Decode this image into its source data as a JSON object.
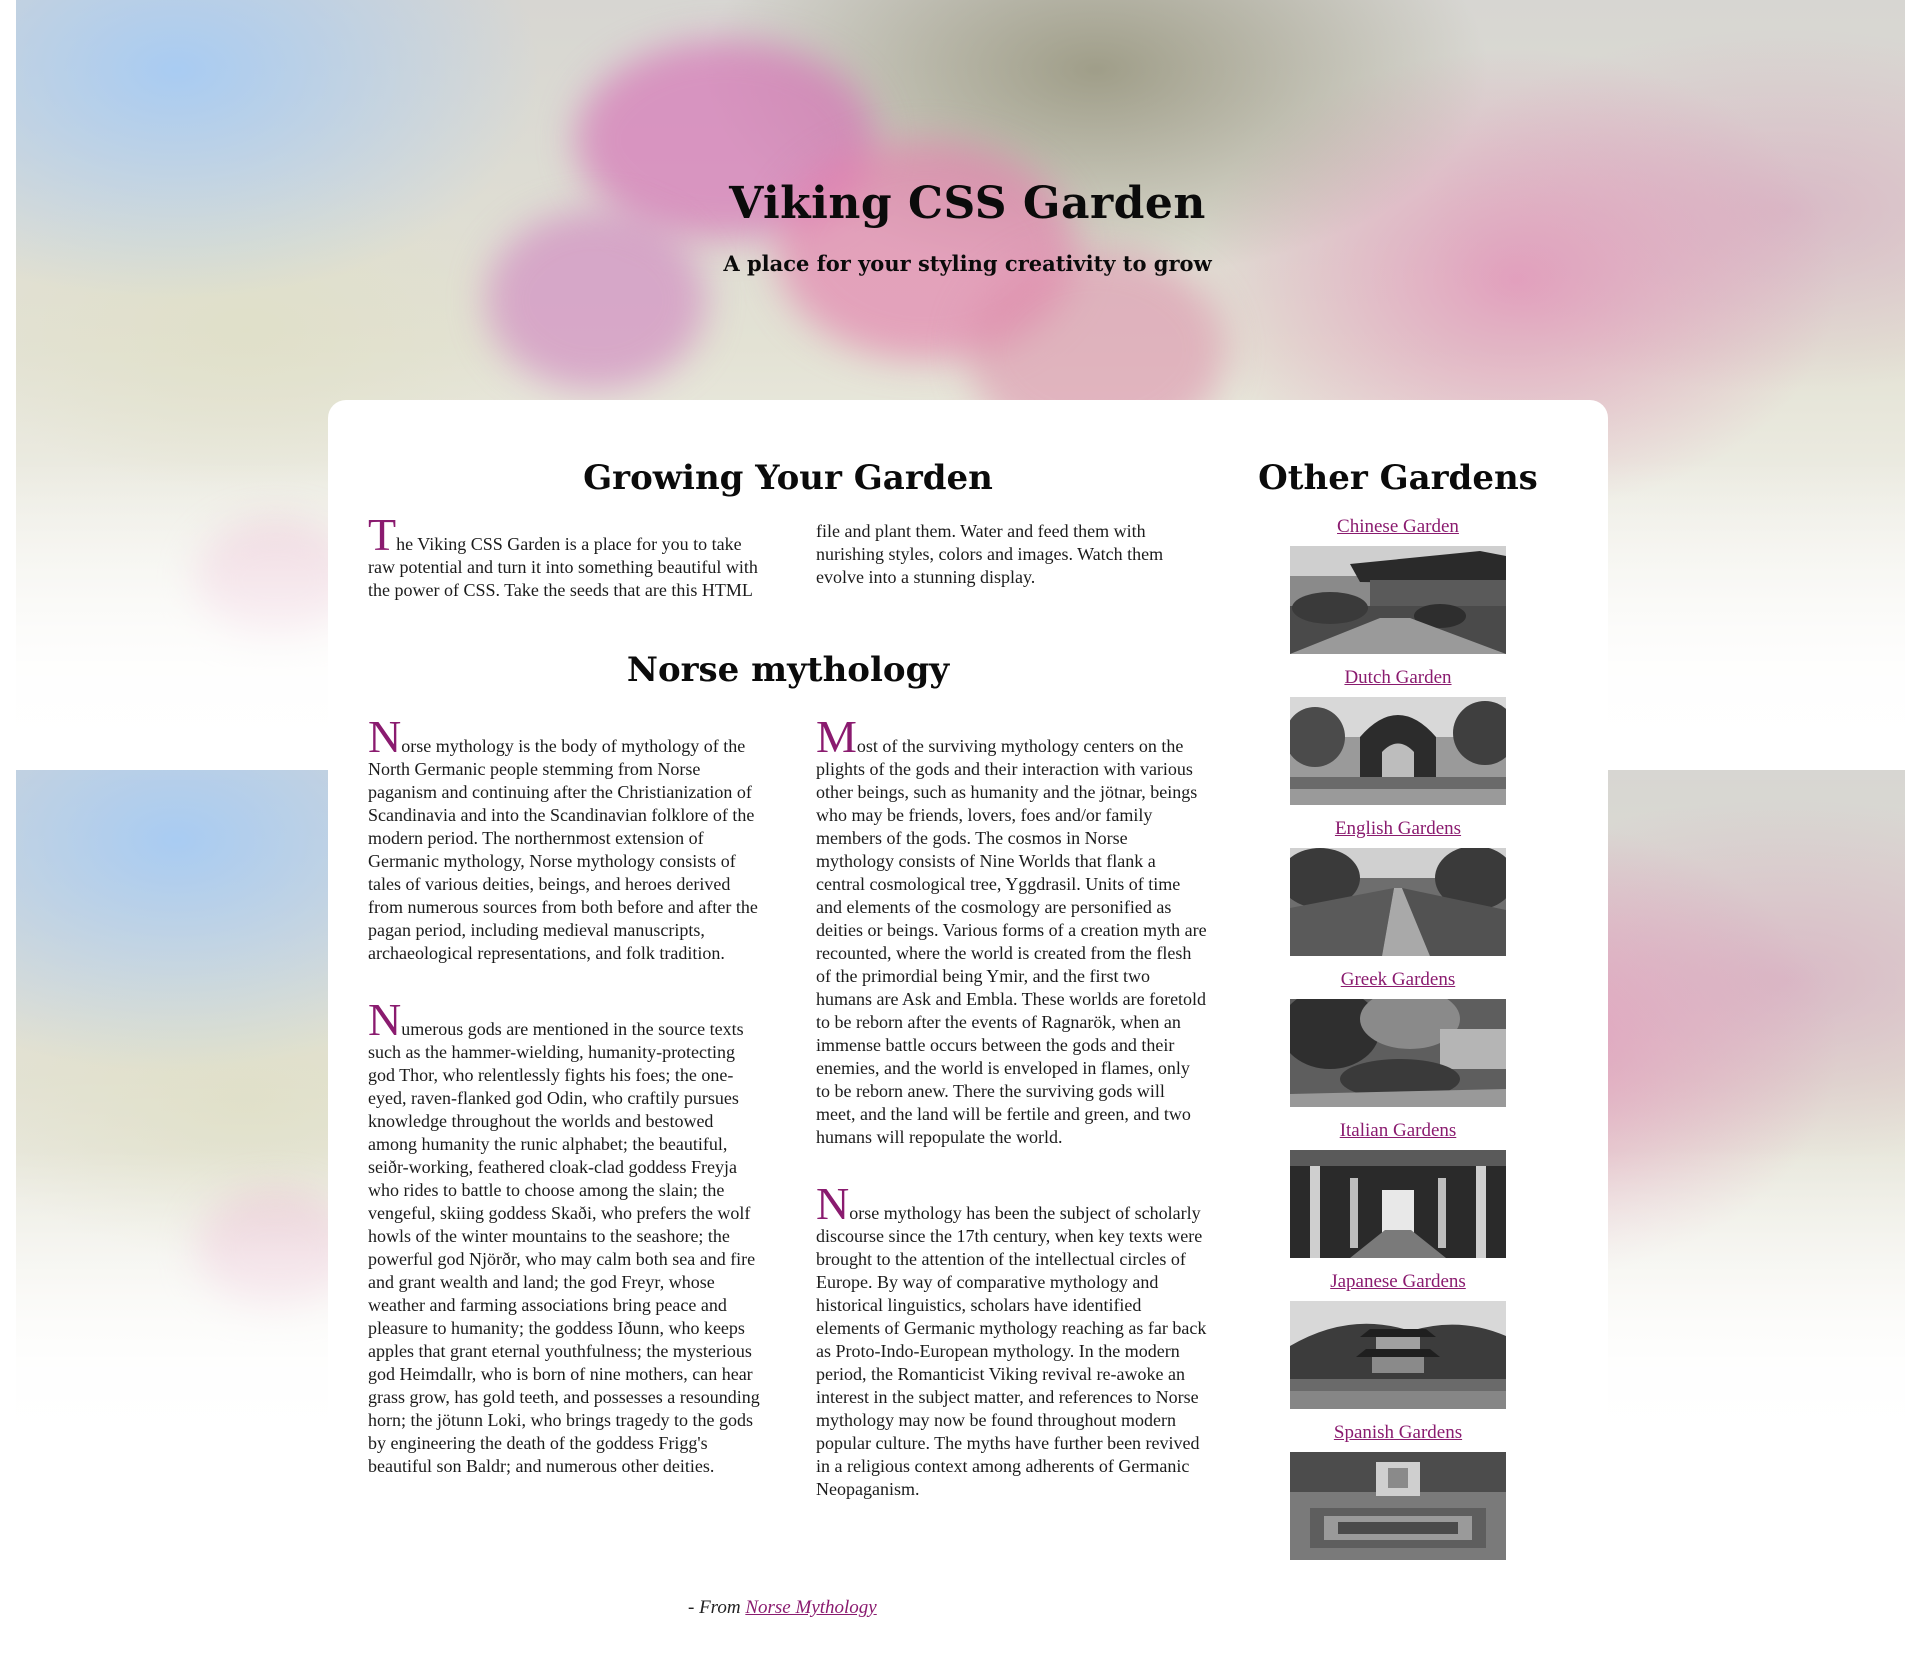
{
  "header": {
    "title": "Viking CSS Garden",
    "tagline": "A place for your styling creativity to grow"
  },
  "growing": {
    "title": "Growing Your Garden",
    "dropcap": "T",
    "text": "he Viking CSS Garden is a place for you to take raw potential and turn it into something beautiful with the power of CSS. Take the seeds that are this HTML file and plant them. Water and feed them with nurishing styles, colors and images. Watch them evolve into a stunning display."
  },
  "norse": {
    "title": "Norse mythology",
    "paragraphs": [
      {
        "dropcap": "N",
        "text": "orse mythology is the body of mythology of the North Germanic people stemming from Norse paganism and continuing after the Christianization of Scandinavia and into the Scandinavian folklore of the modern period. The northernmost extension of Germanic mythology, Norse mythology consists of tales of various deities, beings, and heroes derived from numerous sources from both before and after the pagan period, including medieval manuscripts, archaeological representations, and folk tradition."
      },
      {
        "dropcap": "N",
        "text": "umerous gods are mentioned in the source texts such as the hammer-wielding, humanity-protecting god Thor, who relentlessly fights his foes; the one-eyed, raven-flanked god Odin, who craftily pursues knowledge throughout the worlds and bestowed among humanity the runic alphabet; the beautiful, seiðr-working, feathered cloak-clad goddess Freyja who rides to battle to choose among the slain; the vengeful, skiing goddess Skaði, who prefers the wolf howls of the winter mountains to the seashore; the powerful god Njörðr, who may calm both sea and fire and grant wealth and land; the god Freyr, whose weather and farming associations bring peace and pleasure to humanity; the goddess Iðunn, who keeps apples that grant eternal youthfulness; the mysterious god Heimdallr, who is born of nine mothers, can hear grass grow, has gold teeth, and possesses a resounding horn; the jötunn Loki, who brings tragedy to the gods by engineering the death of the goddess Frigg's beautiful son Baldr; and numerous other deities."
      },
      {
        "dropcap": "M",
        "text": "ost of the surviving mythology centers on the plights of the gods and their interaction with various other beings, such as humanity and the jötnar, beings who may be friends, lovers, foes and/or family members of the gods. The cosmos in Norse mythology consists of Nine Worlds that flank a central cosmological tree, Yggdrasil. Units of time and elements of the cosmology are personified as deities or beings. Various forms of a creation myth are recounted, where the world is created from the flesh of the primordial being Ymir, and the first two humans are Ask and Embla. These worlds are foretold to be reborn after the events of Ragnarök, when an immense battle occurs between the gods and their enemies, and the world is enveloped in flames, only to be reborn anew. There the surviving gods will meet, and the land will be fertile and green, and two humans will repopulate the world."
      },
      {
        "dropcap": "N",
        "text": "orse mythology has been the subject of scholarly discourse since the 17th century, when key texts were brought to the attention of the intellectual circles of Europe. By way of comparative mythology and historical linguistics, scholars have identified elements of Germanic mythology reaching as far back as Proto-Indo-European mythology. In the modern period, the Romanticist Viking revival re-awoke an interest in the subject matter, and references to Norse mythology may now be found throughout modern popular culture. The myths have further been revived in a religious context among adherents of Germanic Neopaganism."
      }
    ],
    "source_prefix": "- From ",
    "source_link": "Norse Mythology"
  },
  "sidebar": {
    "title": "Other Gardens",
    "gardens": [
      {
        "label": "Chinese Garden",
        "image": "chinese-garden-photo"
      },
      {
        "label": "Dutch Garden",
        "image": "dutch-garden-photo"
      },
      {
        "label": "English Gardens",
        "image": "english-garden-photo"
      },
      {
        "label": "Greek Gardens",
        "image": "greek-garden-photo"
      },
      {
        "label": "Italian Gardens",
        "image": "italian-garden-photo"
      },
      {
        "label": "Japanese Gardens",
        "image": "japanese-garden-photo"
      },
      {
        "label": "Spanish Gardens",
        "image": "spanish-garden-photo"
      }
    ]
  },
  "colors": {
    "accent": "#8a1b6f",
    "text": "#1b1b1b",
    "card": "#ffffff"
  }
}
